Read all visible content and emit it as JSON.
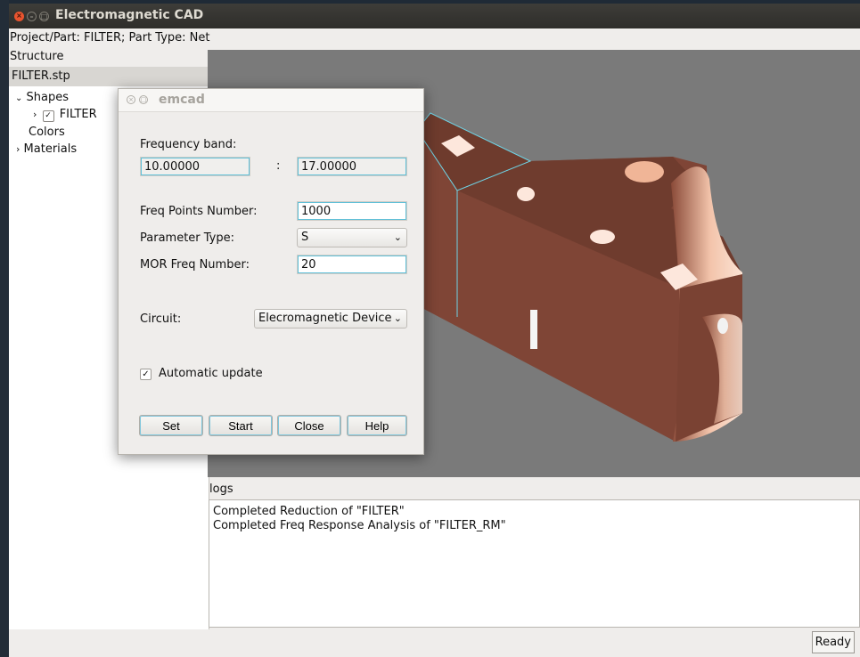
{
  "window": {
    "title": "Electromagnetic CAD",
    "info": "Project/Part: FILTER;  Part Type: Net"
  },
  "structure": {
    "label": "Structure",
    "file": "FILTER.stp",
    "tree": {
      "shapes": "Shapes",
      "filter": "FILTER",
      "colors": "Colors",
      "materials": "Materials"
    }
  },
  "logs": {
    "label": "logs",
    "lines": [
      "Completed Reduction of \"FILTER\"",
      "Completed Freq Response Analysis of \"FILTER_RM\""
    ]
  },
  "status": {
    "ready": "Ready"
  },
  "dialog": {
    "title": "emcad",
    "frequency_band_label": "Frequency band:",
    "freq_min": "10.00000",
    "freq_sep": ":",
    "freq_max": "17.00000",
    "freq_points_label": "Freq Points Number:",
    "freq_points": "1000",
    "param_type_label": "Parameter Type:",
    "param_type": "S",
    "mor_label": "MOR Freq Number:",
    "mor_value": "20",
    "circuit_label": "Circuit:",
    "circuit_value": "Elecromagnetic Device",
    "auto_update_label": "Automatic update",
    "buttons": {
      "set": "Set",
      "start": "Start",
      "close": "Close",
      "help": "Help"
    }
  },
  "colors": {
    "model_face": "#7f4536",
    "model_top": "#6e3b2d",
    "model_light": "#f2c1a8",
    "viewport_bg": "#7a7a7a",
    "highlight": "#5fc0d8"
  }
}
